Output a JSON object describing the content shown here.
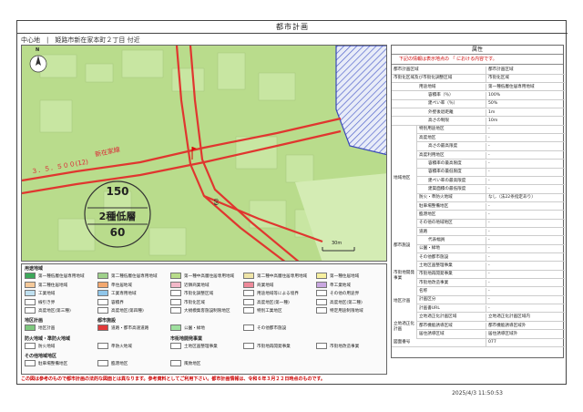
{
  "title": "都市計画",
  "location": "中心地　|　姫路市新在家本町２丁目 付近",
  "map": {
    "zone_code": "150",
    "zone_name": "2種低層",
    "zone_height": "60",
    "far_label": "60",
    "scale_label": "30m",
    "road_labels": [
      "３．５．５００(12)",
      "新在家線"
    ],
    "compass": "N"
  },
  "legend": {
    "section1": "用途地域",
    "zones": [
      {
        "label": "第一種低層住居専用地域",
        "color": "#3da85a"
      },
      {
        "label": "第二種低層住居専用地域",
        "color": "#9fd18b"
      },
      {
        "label": "第一種中高層住居専用地域",
        "color": "#b8dc8a"
      },
      {
        "label": "第二種中高層住居専用地域",
        "color": "#efe5a8"
      },
      {
        "label": "第一種住居地域",
        "color": "#f7f0a0"
      },
      {
        "label": "第二種住居地域",
        "color": "#f4c99a"
      },
      {
        "label": "準住居地域",
        "color": "#f3a86f"
      },
      {
        "label": "近隣商業地域",
        "color": "#f2b8c8"
      },
      {
        "label": "商業地域",
        "color": "#ee8a9a"
      },
      {
        "label": "準工業地域",
        "color": "#c9a7e0"
      },
      {
        "label": "工業地域",
        "color": "#bfe0f0"
      },
      {
        "label": "工業専用地域",
        "color": "#8fc6ea"
      },
      {
        "label": "市街化調整区域",
        "color": "#ffffff"
      },
      {
        "label": "用途地域等による境界",
        "color": "#ffffff"
      },
      {
        "label": "その他の用途界",
        "color": "#ffffff"
      },
      {
        "label": "線引き界",
        "color": "#ffffff"
      },
      {
        "label": "容積界",
        "color": "#ffffff"
      },
      {
        "label": "市街化区域",
        "color": "#ffffff"
      },
      {
        "label": "高度地区(第一種)",
        "color": "#ffffff"
      },
      {
        "label": "高度地区(第二種)",
        "color": "#ffffff"
      },
      {
        "label": "高度地区(第三種)",
        "color": "#ffffff"
      },
      {
        "label": "高度地区(第四種)",
        "color": "#ffffff"
      },
      {
        "label": "大規模集客施設制限地区",
        "color": "#ffffff"
      },
      {
        "label": "特別工業地区",
        "color": "#ffffff"
      },
      {
        "label": "特定用途制限地域",
        "color": "#ffffff"
      }
    ],
    "section2": "地区計画",
    "district": [
      {
        "label": "地区計画",
        "color": "#7ec87e"
      }
    ],
    "section3": "都市施設",
    "facilities": [
      {
        "label": "道路・都市高速道路",
        "color": "#e23a3a"
      },
      {
        "label": "公園・緑地",
        "color": "#9fe09f"
      },
      {
        "label": "その他都市施設",
        "color": "#ffffff"
      }
    ],
    "section4": "防火地域・準防火地域",
    "section5": "市街地開発事業",
    "fire": [
      {
        "label": "防火地域",
        "color": "#ffffff"
      },
      {
        "label": "準防火地域",
        "color": "#ffffff"
      },
      {
        "label": "土地区画整理事業",
        "color": "#ffffff"
      },
      {
        "label": "市街地再開発事業",
        "color": "#ffffff"
      },
      {
        "label": "市街地改造事業",
        "color": "#ffffff"
      }
    ],
    "section6": "その他地域地区",
    "others": [
      {
        "label": "駐車場整備地区",
        "color": "#ffffff"
      },
      {
        "label": "臨港地区",
        "color": "#ffffff"
      },
      {
        "label": "風致地区",
        "color": "#ffffff"
      }
    ]
  },
  "note": "この図は参考のもので都市計画の法的な図面とは異なります。参考資料としてご利用下さい。都市計画情報は、令和６年３月２２日時点のものです。",
  "attributes": {
    "header": "属性",
    "sub": "下記の情報は表示地点の 「 における内容です。",
    "rows": [
      {
        "k": "都市計画区域",
        "v": "都市計画区域"
      },
      {
        "k": "市街化区域及び市街化調整区域",
        "v": "市街化区域"
      },
      {
        "k": "用途地域",
        "v": "第一種低層住居専用地域"
      },
      {
        "k": "容積率（％）",
        "v": "100%"
      },
      {
        "k": "建ぺい率（％）",
        "v": "50%"
      },
      {
        "k": "外壁後退距離",
        "v": "1m"
      },
      {
        "k": "高さの制限",
        "v": "10m"
      },
      {
        "k": "特別用途地区",
        "v": "-"
      },
      {
        "k": "高度地区",
        "v": "-"
      },
      {
        "k": "高さの最高限度",
        "v": "-"
      },
      {
        "k": "高度利用地区",
        "v": "-"
      },
      {
        "k": "容積率の最高限度",
        "v": "-"
      },
      {
        "k": "容積率の最低限度",
        "v": "-"
      },
      {
        "k": "建ぺい率の最高限度",
        "v": "-"
      },
      {
        "k": "建築面積の最低限度",
        "v": "-"
      },
      {
        "k": "防火・準防火地域",
        "v": "なし（法22条指定あり）"
      },
      {
        "k": "駐車場整備地区",
        "v": "-"
      },
      {
        "k": "臨港地区",
        "v": "-"
      },
      {
        "k": "その他の地域地区",
        "v": "-"
      },
      {
        "k": "道路",
        "v": "-"
      },
      {
        "k": "代表幅員",
        "v": "-"
      },
      {
        "k": "公園・緑地",
        "v": "-"
      },
      {
        "k": "その他都市施設",
        "v": "-"
      },
      {
        "k": "土地区画整理事業",
        "v": "-"
      },
      {
        "k": "市街地再開発事業",
        "v": "-"
      },
      {
        "k": "市街地改造事業",
        "v": "-"
      },
      {
        "k": "名称",
        "v": "-"
      },
      {
        "k": "計画区分",
        "v": "-"
      },
      {
        "k": "計画書URL",
        "v": "-"
      },
      {
        "k": "立地適正化計画区域",
        "v": "立地適正化計画区域内"
      },
      {
        "k": "都市機能誘導区域",
        "v": "都市機能誘導区域外"
      },
      {
        "k": "居住誘導区域",
        "v": "居住誘導区域外"
      },
      {
        "k": "図面番号",
        "v": "077"
      }
    ],
    "groups": [
      "地域地区",
      "都市施設",
      "市街地開発事業",
      "地区計画",
      "立地適正化計画"
    ]
  },
  "timestamp": "2025/4/3  11:50:53"
}
